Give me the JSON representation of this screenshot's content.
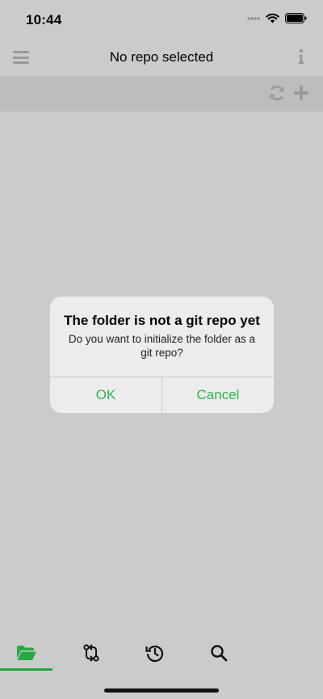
{
  "status_bar": {
    "time": "10:44",
    "icons": [
      "signal-dots-icon",
      "wifi-icon",
      "battery-icon"
    ]
  },
  "nav": {
    "title": "No repo selected",
    "left_icon": "hamburger-menu-icon",
    "right_icon": "info-icon"
  },
  "toolbar": {
    "icons": [
      "refresh-icon",
      "add-icon"
    ]
  },
  "alert": {
    "title": "The folder is not a git repo yet",
    "message": "Do you want to initialize the folder as a git repo?",
    "ok_label": "OK",
    "cancel_label": "Cancel"
  },
  "tab_bar": {
    "tabs": [
      {
        "icon": "folder-open-icon",
        "selected": true
      },
      {
        "icon": "sync-changes-icon",
        "selected": false
      },
      {
        "icon": "history-icon",
        "selected": false
      },
      {
        "icon": "search-icon",
        "selected": false
      }
    ]
  },
  "colors": {
    "accent": "#2eb84b",
    "tab_indicator": "#28a745",
    "background": "#cbcbcb",
    "toolbar": "#bdbdbd",
    "alert_background": "#ececec",
    "muted_icon": "#9a9a9a"
  }
}
